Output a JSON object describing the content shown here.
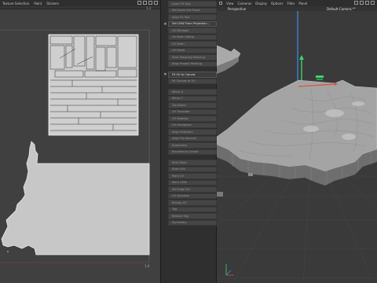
{
  "uv_editor": {
    "menu": [
      "Texture Selection",
      "Paint",
      "Stickers"
    ],
    "tick_left_top": "1",
    "tick_right_top": "1,1",
    "tick_right_bottom": "1,0",
    "tick_left_bottom": "0"
  },
  "tools": {
    "items": [
      {
        "label": "Layer Fit Tool",
        "active": false,
        "marked": false
      },
      {
        "label": "Set Same Set Pixels",
        "active": false,
        "marked": false
      },
      {
        "label": "Align Fit Tool",
        "active": false,
        "marked": false
      },
      {
        "label": "Set UVW From Projection...",
        "active": true,
        "marked": true
      },
      {
        "label": "UV Manager",
        "active": false,
        "marked": false
      },
      {
        "label": "UV Mesh Fitting",
        "active": false,
        "marked": false
      },
      {
        "label": "UV Mesh",
        "active": false,
        "marked": false
      },
      {
        "label": "UV Fields",
        "active": false,
        "marked": false
      },
      {
        "label": "Start Mapping Relaxing",
        "active": false,
        "marked": false
      },
      {
        "label": "Align Project Painting",
        "active": false,
        "marked": false
      },
      {
        "label": "Fit UV to Canvas",
        "active": true,
        "marked": true
      },
      {
        "label": "Fit Canvas to UV",
        "active": false,
        "marked": false
      },
      {
        "label": "Mirror X",
        "active": false,
        "marked": false
      },
      {
        "label": "Mirror Y",
        "active": false,
        "marked": false
      },
      {
        "label": "Transform",
        "active": false,
        "marked": false
      },
      {
        "label": "UV Translate",
        "active": false,
        "marked": false
      },
      {
        "label": "UV Rotation",
        "active": false,
        "marked": false
      },
      {
        "label": "UV Straighten",
        "active": false,
        "marked": false
      },
      {
        "label": "Align Selection",
        "active": false,
        "marked": false
      },
      {
        "label": "Align Flip Normal",
        "active": false,
        "marked": false
      },
      {
        "label": "Interactive",
        "active": false,
        "marked": false
      },
      {
        "label": "Rounded to Center",
        "active": false,
        "marked": false
      },
      {
        "label": "Start Point",
        "active": false,
        "marked": false
      },
      {
        "label": "Start UVs",
        "active": false,
        "marked": false
      },
      {
        "label": "Paint UV",
        "active": false,
        "marked": false
      },
      {
        "label": "Paint UVW",
        "active": false,
        "marked": false
      },
      {
        "label": "Set Edge Sel",
        "active": false,
        "marked": false
      },
      {
        "label": "UV Quantize",
        "active": false,
        "marked": false
      },
      {
        "label": "Remap UV",
        "active": false,
        "marked": false
      },
      {
        "label": "Tag",
        "active": false,
        "marked": false
      },
      {
        "label": "Restore Tag",
        "active": false,
        "marked": false
      },
      {
        "label": "Symmetry",
        "active": false,
        "marked": false
      }
    ]
  },
  "viewport": {
    "menu": [
      "View",
      "Cameras",
      "Display",
      "Options",
      "Filter",
      "Panel"
    ],
    "title": "Perspective",
    "camera": "Default Camera *°",
    "colors": {
      "x_axis": "#e24b3a",
      "y_axis": "#3ed36a",
      "z_axis": "#3a8ff0"
    }
  }
}
